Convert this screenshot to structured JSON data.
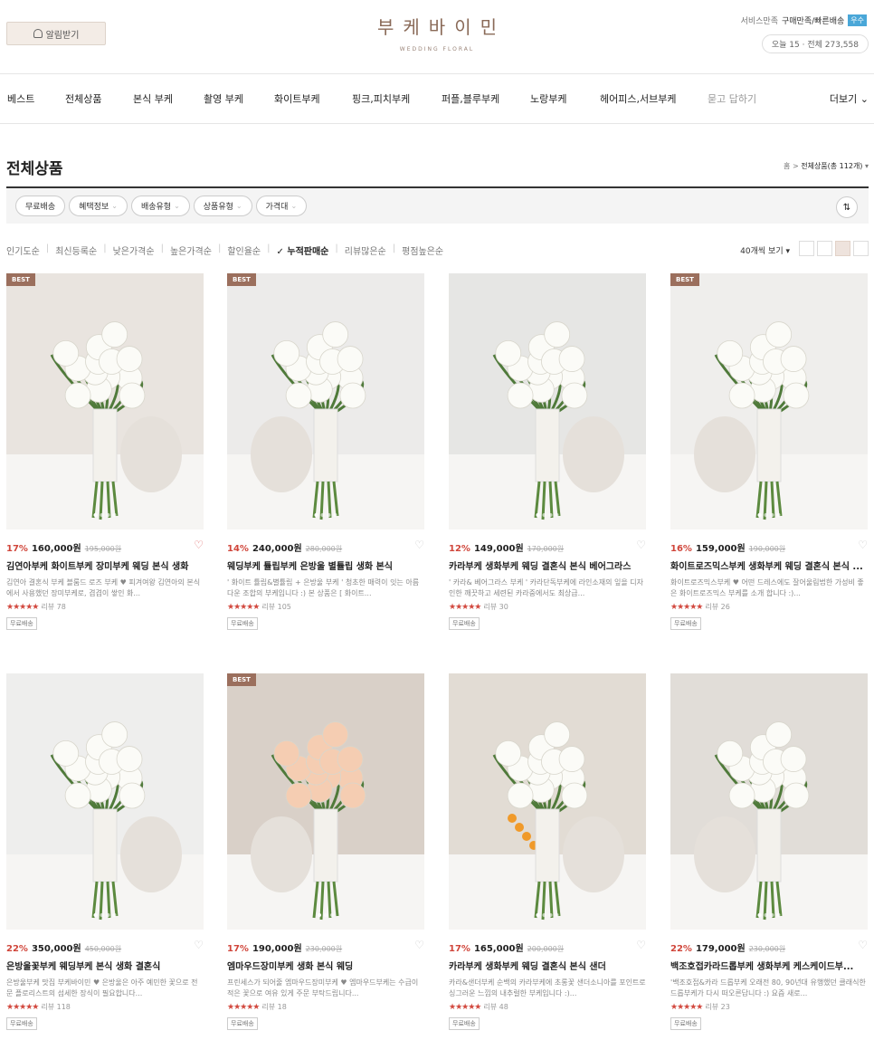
{
  "header": {
    "alarm_label": "알림받기",
    "logo_ko": "부케바이민",
    "logo_en": "WEDDING FLORAL",
    "svc_label": "서비스만족",
    "svc_value": "구매만족/빠른배송",
    "svc_badge": "우수",
    "stats": "오늘 15 · 전체 273,558"
  },
  "nav": {
    "items": [
      "베스트",
      "전체상품",
      "본식 부케",
      "촬영 부케",
      "화이트부케",
      "핑크,피치부케",
      "퍼플,블루부케",
      "노랑부케",
      "헤어피스,서브부케",
      "묻고 답하기"
    ],
    "more": "더보기"
  },
  "page": {
    "title": "전체상품",
    "crumb_home": "홈",
    "crumb_current": "전체상품(총 112개)"
  },
  "filters": [
    "무료배송",
    "혜택정보",
    "배송유형",
    "상품유형",
    "가격대"
  ],
  "sort": {
    "options": [
      "인기도순",
      "최신등록순",
      "낮은가격순",
      "높은가격순",
      "할인율순",
      "누적판매순",
      "리뷰많은순",
      "평점높은순"
    ],
    "active": "누적판매순",
    "per_page": "40개씩 보기"
  },
  "products": [
    {
      "best": "BEST",
      "pct": "17%",
      "price": "160,000원",
      "old": "195,000원",
      "name": "김연아부케 화이트부케 장미부케 웨딩 본식 생화",
      "desc": "김연아 결혼식 부케 블룸드 로즈 부케 ♥ 피겨여왕 김연아의 본식에서 사용했던 장미부케로, 겹겹이 쌓인 화...",
      "reviews": "리뷰 78",
      "ship": "무료배송",
      "liked": true
    },
    {
      "best": "BEST",
      "pct": "14%",
      "price": "240,000원",
      "old": "280,000원",
      "name": "웨딩부케 튤립부케 은방울 별튤립 생화 본식",
      "desc": "' 화이트 튤립&별튤립 + 은방울 부케 ' 청초한 매력이 잇는 아름다운 조합의 부케입니다 :) 본 상품은 [ 화이트...",
      "reviews": "리뷰 105",
      "ship": "무료배송",
      "liked": false
    },
    {
      "best": "",
      "pct": "12%",
      "price": "149,000원",
      "old": "170,000원",
      "name": "카라부케 생화부케 웨딩 결혼식 본식 베어그라스",
      "desc": "' 카라& 베어그라스 부케 ' 카라단독부케에 라인소재의 잎을 디자인한 깨끗하고 세련된 카라중에서도 최상급...",
      "reviews": "리뷰 30",
      "ship": "무료배송",
      "liked": false
    },
    {
      "best": "BEST",
      "pct": "16%",
      "price": "159,000원",
      "old": "190,000원",
      "name": "화이트로즈믹스부케 생화부케 웨딩 결혼식 본식 ...",
      "desc": "화이트로즈믹스부케 ♥ 어떤 드레스에도 잘어울림법한 가성비 좋은 화이트로즈믹스 부케를 소개 합니다 :)...",
      "reviews": "리뷰 26",
      "ship": "무료배송",
      "liked": false
    },
    {
      "best": "",
      "pct": "22%",
      "price": "350,000원",
      "old": "450,000원",
      "name": "은방울꽃부케 웨딩부케 본식 생화 결혼식",
      "desc": "은방울부케 맛집 부케바이민 ♥ 은방울은 아주 예민한 꽃으로 전문 플로리스트의 섬세한 장식이 필요합니다...",
      "reviews": "리뷰 118",
      "ship": "무료배송",
      "liked": false
    },
    {
      "best": "BEST",
      "pct": "17%",
      "price": "190,000원",
      "old": "230,000원",
      "name": "엠마우드장미부케 생화 본식 웨딩",
      "desc": "프린세스가 되어줄 엠마우드장미부케 ♥ 엠마우드부케는 수급이 적은 꽃으로 여유 있게 주문 부탁드립니다...",
      "reviews": "리뷰 18",
      "ship": "무료배송",
      "liked": false
    },
    {
      "best": "",
      "pct": "17%",
      "price": "165,000원",
      "old": "200,000원",
      "name": "카라부케 생화부케 웨딩 결혼식 본식 샌더",
      "desc": "카라&샌더부케 순백의 카라부케에 초롱꽃 샌더소니아를 포인트로 싱그러운 느낌의 내추럴한 부케입니다 :)...",
      "reviews": "리뷰 48",
      "ship": "무료배송",
      "liked": false
    },
    {
      "best": "",
      "pct": "22%",
      "price": "179,000원",
      "old": "230,000원",
      "name": "백조호접카라드롭부케 생화부케 케스케이드부...",
      "desc": "'백조호접&카라 드롭부케 오래전 80, 90년대 유행했던 클래식한 드롭부케가 다시 떠오른답니다 :) 요즘 새로...",
      "reviews": "리뷰 23",
      "ship": "무료배송",
      "liked": false
    }
  ]
}
